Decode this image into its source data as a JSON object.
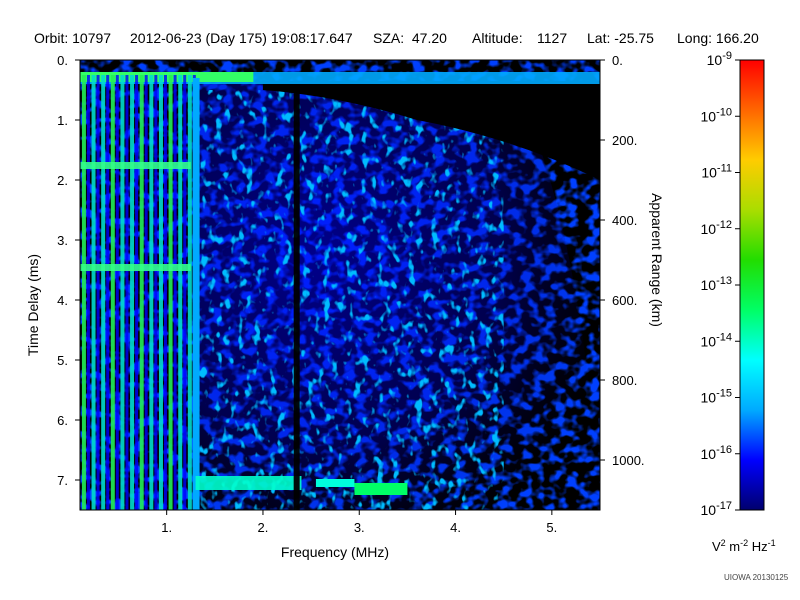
{
  "header": {
    "orbit": "Orbit: 10797",
    "datetime": "2012-06-23 (Day 175) 19:08:17.647",
    "sza": "SZA:  47.20",
    "altitude_label": "Altitude:",
    "altitude_value": "1127",
    "lat": "Lat: -25.75",
    "long": "Long: 166.20"
  },
  "credit": "UIOWA 20130125",
  "colors": {
    "background": "#000000",
    "colormap": [
      "#00006e",
      "#0000ff",
      "#00aaff",
      "#00ffff",
      "#00ff66",
      "#22dd00",
      "#aadd00",
      "#ffcc00",
      "#ff6600",
      "#ff0000"
    ]
  },
  "chart_data": {
    "type": "heatmap",
    "title": "",
    "xlabel": "Frequency (MHz)",
    "ylabel": "Time Delay (ms)",
    "y2label": "Apparent Range (km)",
    "xlim": [
      0.1,
      5.5
    ],
    "ylim": [
      0.0,
      7.5
    ],
    "y_inverted": true,
    "x_ticks": [
      1,
      2,
      3,
      4,
      5
    ],
    "x_tick_labels": [
      "1.",
      "2.",
      "3.",
      "4.",
      "5."
    ],
    "y_ticks": [
      0,
      1,
      2,
      3,
      4,
      5,
      6,
      7
    ],
    "y_tick_labels": [
      "0.",
      "1.",
      "2.",
      "3.",
      "4.",
      "5.",
      "6.",
      "7."
    ],
    "y2_ticks": [
      0,
      200,
      400,
      600,
      800,
      1000
    ],
    "y2_tick_labels": [
      "0.",
      "200.",
      "400.",
      "600.",
      "800.",
      "1000."
    ],
    "y2_lim_km": [
      0,
      1125
    ],
    "colorbar": {
      "label": "V2 m-2 Hz-1",
      "scale": "log",
      "range": [
        1e-17,
        1e-09
      ],
      "ticks": [
        {
          "base": "10",
          "exp": "-9"
        },
        {
          "base": "10",
          "exp": "-10"
        },
        {
          "base": "10",
          "exp": "-11"
        },
        {
          "base": "10",
          "exp": "-12"
        },
        {
          "base": "10",
          "exp": "-13"
        },
        {
          "base": "10",
          "exp": "-14"
        },
        {
          "base": "10",
          "exp": "-15"
        },
        {
          "base": "10",
          "exp": "-16"
        },
        {
          "base": "10",
          "exp": "-17"
        }
      ]
    },
    "features": [
      {
        "name": "surface echo",
        "freq_range_mhz": [
          0.1,
          5.5
        ],
        "delay_ms": 0.3,
        "level": 1e-15
      },
      {
        "name": "low-frequency vertical lines",
        "freq_range_mhz": [
          0.1,
          1.3
        ],
        "level": 1e-14
      },
      {
        "name": "plasma line",
        "freq_mhz": 1.3,
        "delay_range_ms": [
          0.3,
          7.5
        ],
        "level": 1e-15
      },
      {
        "name": "late echo",
        "freq_range_mhz": [
          1.3,
          3.5
        ],
        "delay_ms": 7.05,
        "level": 1e-14
      },
      {
        "name": "gap",
        "freq_mhz": 2.35,
        "delay_range_ms": [
          0.5,
          7.5
        ]
      }
    ]
  }
}
